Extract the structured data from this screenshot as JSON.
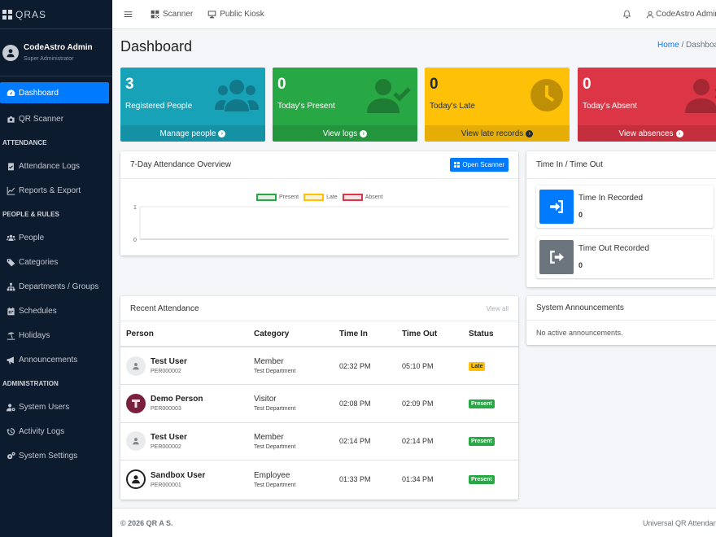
{
  "brand": {
    "name": "QRAS"
  },
  "user": {
    "name": "CodeAstro Admin",
    "role": "Super Administrator"
  },
  "nav": {
    "dashboard": "Dashboard",
    "qr_scanner": "QR Scanner",
    "header_attendance": "ATTENDANCE",
    "attendance_logs": "Attendance Logs",
    "reports": "Reports & Export",
    "header_people": "PEOPLE & RULES",
    "people": "People",
    "categories": "Categories",
    "departments": "Departments / Groups",
    "schedules": "Schedules",
    "holidays": "Holidays",
    "announcements": "Announcements",
    "header_admin": "ADMINISTRATION",
    "system_users": "System Users",
    "activity_logs": "Activity Logs",
    "system_settings": "System Settings"
  },
  "topbar": {
    "scanner": "Scanner",
    "kiosk": "Public Kiosk",
    "admin": "CodeAstro Admin"
  },
  "page": {
    "title": "Dashboard",
    "breadcrumb_home": "Home",
    "breadcrumb_sep": "/",
    "breadcrumb_current": "Dashboard"
  },
  "stats": [
    {
      "value": "3",
      "label": "Registered People",
      "link": "Manage people"
    },
    {
      "value": "0",
      "label": "Today's Present",
      "link": "View logs"
    },
    {
      "value": "0",
      "label": "Today's Late",
      "link": "View late records"
    },
    {
      "value": "0",
      "label": "Today's Absent",
      "link": "View absences"
    }
  ],
  "overview": {
    "title": "7-Day Attendance Overview",
    "button": "Open Scanner"
  },
  "chart_data": {
    "type": "line",
    "series": [
      {
        "name": "Present",
        "color": "#28a745",
        "values": []
      },
      {
        "name": "Late",
        "color": "#ffc107",
        "values": []
      },
      {
        "name": "Absent",
        "color": "#dc3545",
        "values": []
      }
    ],
    "y_ticks": [
      "1",
      "0"
    ],
    "ylim": [
      0,
      1
    ],
    "grid": true,
    "legend": "top"
  },
  "timeinout": {
    "title": "Time In / Time Out",
    "in_label": "Time In Recorded",
    "in_value": "0",
    "out_label": "Time Out Recorded",
    "out_value": "0"
  },
  "recent": {
    "title": "Recent Attendance",
    "view_all": "View all",
    "columns": [
      "Person",
      "Category",
      "Time In",
      "Time Out",
      "Status"
    ],
    "rows": [
      {
        "name": "Test User",
        "id": "PER000002",
        "category": "Member",
        "department": "Test Department",
        "time_in": "02:32 PM",
        "time_out": "05:10 PM",
        "status": "Late"
      },
      {
        "name": "Demo Person",
        "id": "PER000003",
        "category": "Visitor",
        "department": "Test Department",
        "time_in": "02:08 PM",
        "time_out": "02:09 PM",
        "status": "Present"
      },
      {
        "name": "Test User",
        "id": "PER000002",
        "category": "Member",
        "department": "Test Department",
        "time_in": "02:14 PM",
        "time_out": "02:14 PM",
        "status": "Present"
      },
      {
        "name": "Sandbox User",
        "id": "PER000001",
        "category": "Employee",
        "department": "Test Department",
        "time_in": "01:33 PM",
        "time_out": "01:34 PM",
        "status": "Present"
      }
    ]
  },
  "announcements": {
    "title": "System Announcements",
    "empty": "No active announcements."
  },
  "footer": {
    "copyright": "© 2026 QR A S.",
    "right": "Universal QR Attendance"
  }
}
